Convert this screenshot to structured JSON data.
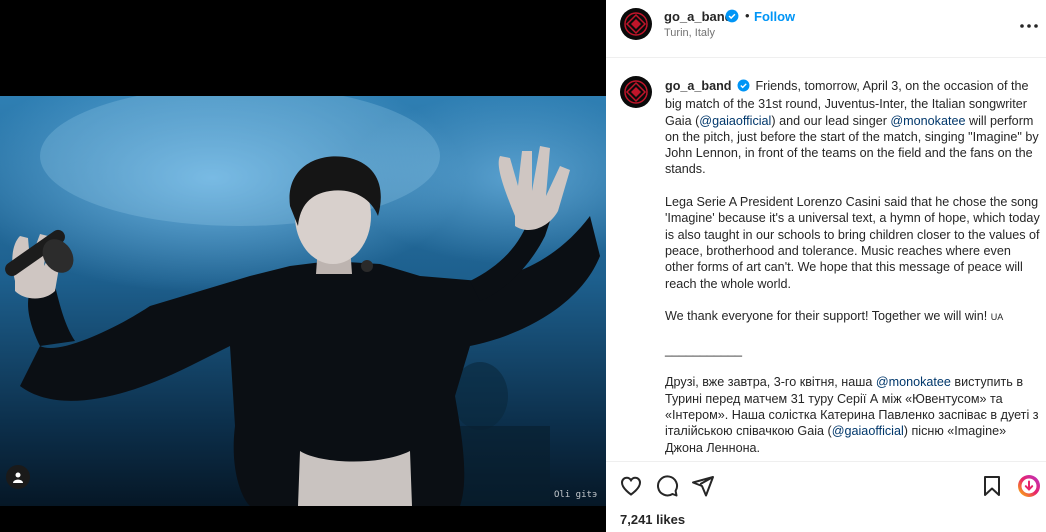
{
  "post": {
    "username": "go_a_band",
    "follow_label": "Follow",
    "separator": "•",
    "location": "Turin, Italy",
    "likes": "7,241 likes"
  },
  "media": {
    "watermark": "Oli gitэ"
  },
  "caption": {
    "username": "go_a_band",
    "p1_text1": "Friends, tomorrow, April 3, on the occasion of the big match of the 31st round, Juventus-Inter, the Italian songwriter Gaia (",
    "p1_mention1": "@gaiaofficial",
    "p1_text2": ") and our lead singer ",
    "p1_mention2": "@monokatee",
    "p1_text3": " will perform on the pitch, just before the start of the match, singing \"Imagine\" by John Lennon, in front of the teams on the field and the fans on the stands.",
    "p2": "Lega Serie A President Lorenzo Casini said that he chose the song 'Imagine' because it's a universal text, a hymn of hope, which today is also taught in our schools to bring children closer to the values of peace, brotherhood and tolerance. Music reaches where even other forms of art can't. We hope that this message of peace will reach the whole world.",
    "p3_text": "We thank everyone for their support! Together we will win! ",
    "p3_flag": "UA",
    "divider": "___________",
    "p4_text1": "Друзі, вже завтра, 3-го квітня, наша ",
    "p4_mention1": "@monokatee",
    "p4_text2": " виступить в Турині перед матчем 31 туру Серії А між «Ювентусом» та «Інтером». Наша солістка Катерина Павленко заспіває в дуеті з італійською співачкою Gaia (",
    "p4_mention2": "@gaiaofficial",
    "p4_text3": ") пісню «Imagine» Джона Леннона."
  },
  "colors": {
    "accent": "#0095f6",
    "mention": "#00376b",
    "verified": "#0095f6",
    "text": "#262626",
    "muted": "#737373"
  },
  "icons": [
    "user-tag-icon",
    "verified-badge-icon",
    "more-options-icon",
    "like-heart-icon",
    "comment-icon",
    "share-icon",
    "save-bookmark-icon",
    "reels-badge-icon"
  ]
}
